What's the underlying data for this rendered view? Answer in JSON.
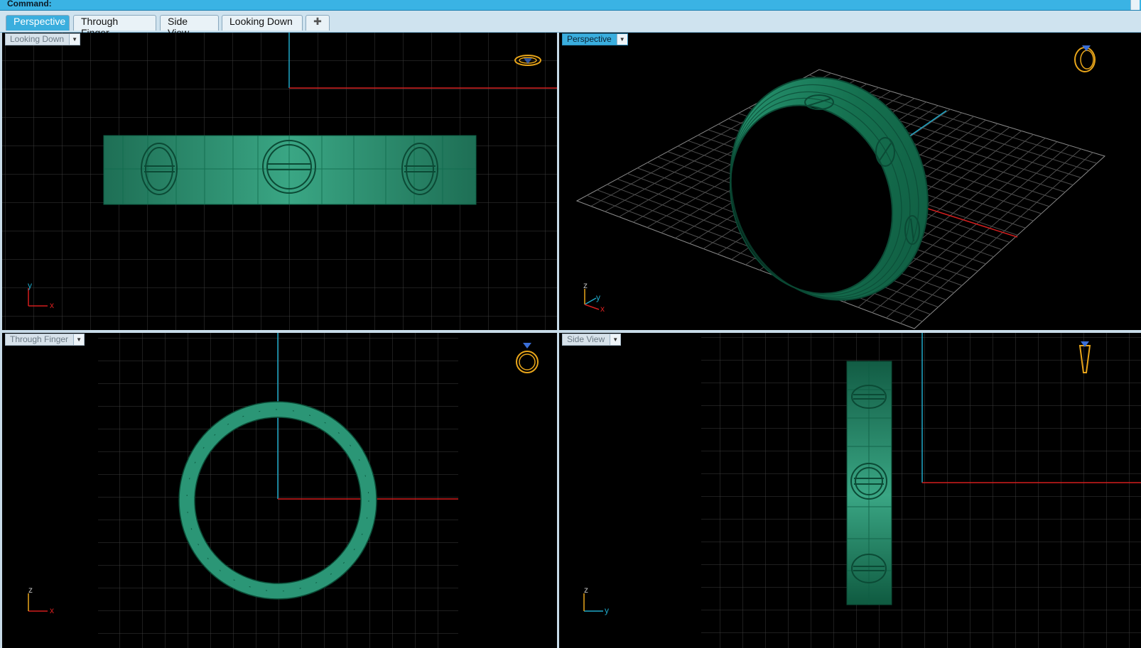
{
  "command": {
    "label": "Command:"
  },
  "tabs": [
    {
      "label": "Perspective",
      "active": true
    },
    {
      "label": "Through Finger",
      "active": false
    },
    {
      "label": "Side View",
      "active": false
    },
    {
      "label": "Looking Down",
      "active": false
    }
  ],
  "add_tab_icon": "plus-icon",
  "viewports": {
    "top_left": {
      "label": "Looking Down",
      "axis_vertical": "y",
      "axis_horizontal": "x"
    },
    "top_right": {
      "label": "Perspective",
      "axis_z": "z",
      "axis_y": "y",
      "axis_x": "x"
    },
    "bottom_left": {
      "label": "Through Finger",
      "axis_vertical": "z",
      "axis_horizontal": "x"
    },
    "bottom_right": {
      "label": "Side View",
      "axis_vertical": "z",
      "axis_horizontal": "y"
    }
  },
  "colors": {
    "ring": "#1f8a66",
    "ring_edge": "#0e5d43",
    "grid": "#4a4a4a",
    "axis_x": "#d21e1e",
    "axis_y": "#1fa8c8",
    "tab_active": "#3aaede",
    "gizmo": "#e8a51a"
  }
}
